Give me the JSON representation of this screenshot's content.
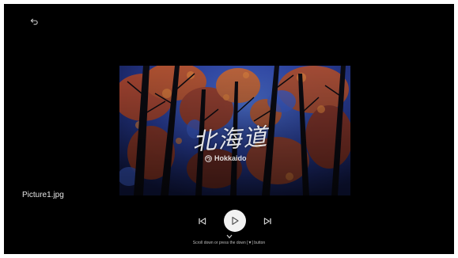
{
  "viewer": {
    "back_icon": "back-arrow-icon",
    "file_name": "Picture1.jpg"
  },
  "photo": {
    "title": "北海道",
    "subtitle": "Hokkaido",
    "subtitle_icon": "swirl-icon"
  },
  "controls": {
    "prev_icon": "skip-previous-icon",
    "play_icon": "play-icon",
    "next_icon": "skip-next-icon"
  },
  "hint": {
    "icon": "chevron-down-icon",
    "text": "Scroll down or press the down [▼] button"
  },
  "colors": {
    "background": "#000000",
    "frame": "#ffffff",
    "play_button": "#f2f2f2",
    "sky": "#2a3f9e",
    "foliage": "#c4572a"
  }
}
